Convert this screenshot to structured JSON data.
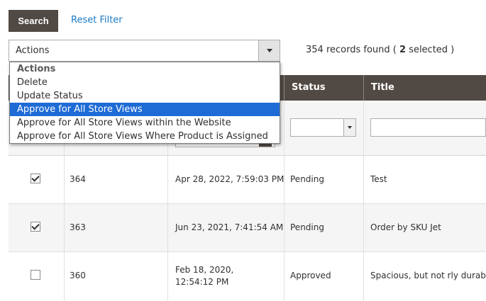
{
  "toolbar": {
    "search_label": "Search",
    "reset_label": "Reset Filter"
  },
  "actions": {
    "selected_label": "Actions",
    "options": [
      {
        "label": "Actions",
        "type": "group"
      },
      {
        "label": "Delete"
      },
      {
        "label": "Update Status"
      },
      {
        "label": "Approve for All Store Views",
        "highlighted": true
      },
      {
        "label": "Approve for All Store Views within the Website"
      },
      {
        "label": "Approve for All Store Views Where Product is Assigned"
      }
    ]
  },
  "records": {
    "text_before": "354 records found (",
    "selected_count": "2",
    "text_after": "selected )"
  },
  "grid": {
    "columns": [
      "Status",
      "Title"
    ],
    "rows": [
      {
        "checked": true,
        "id": "364",
        "date": "Apr 28, 2022, 7:59:03 PM",
        "status": "Pending",
        "title": "Test"
      },
      {
        "checked": true,
        "id": "363",
        "date": "Jun 23, 2021, 7:41:54 AM",
        "status": "Pending",
        "title": "Order by SKU Jet"
      },
      {
        "checked": false,
        "id": "360",
        "date_line1": "Feb 18, 2020,",
        "date_line2": "12:54:12 PM",
        "status": "Approved",
        "title": "Spacious, but not rly durable"
      }
    ]
  },
  "colors": {
    "header_bg": "#514943",
    "link": "#1979c3",
    "highlight": "#1e6bd6"
  }
}
